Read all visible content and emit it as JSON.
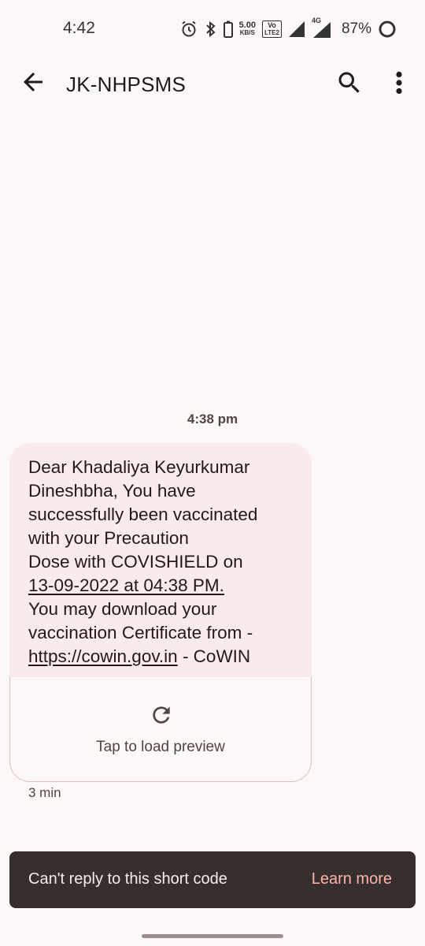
{
  "status_bar": {
    "time": "4:42",
    "net_speed_value": "5.00",
    "net_speed_unit": "KB/S",
    "volte_top": "Vo",
    "volte_bottom": "LTE2",
    "network_type": "4G",
    "battery_percent": "87%",
    "icons": [
      "alarm-icon",
      "bluetooth-icon",
      "volte-icon",
      "signal-icon",
      "signal-4g-icon",
      "battery-ring-icon"
    ]
  },
  "app_bar": {
    "title": "JK-NHPSMS",
    "icons": [
      "back-arrow-icon",
      "search-icon",
      "more-vert-icon"
    ]
  },
  "conversation": {
    "timestamp": "4:38 pm",
    "message": {
      "line1": "Dear Khadaliya Keyurkumar",
      "line2": "Dineshbha, You have",
      "line3": "successfully been vaccinated",
      "line4": "with your Precaution",
      "line5": "Dose with COVISHIELD on",
      "line6_link": "13-09-2022 at 04:38 PM.",
      "line7": "You may download your",
      "line8": "vaccination Certificate from -",
      "line9_link": "https://cowin.gov.in",
      "line9_rest": " - CoWIN"
    },
    "preview": {
      "label": "Tap to load preview",
      "icon": "refresh-icon"
    },
    "age": "3 min"
  },
  "snackbar": {
    "text": "Can't reply to this short code",
    "action": "Learn more"
  },
  "colors": {
    "background": "#fdf8f7",
    "bubble": "#f9ebea",
    "snackbar": "#362f2e",
    "snackbar_action": "#ffb4a8"
  }
}
